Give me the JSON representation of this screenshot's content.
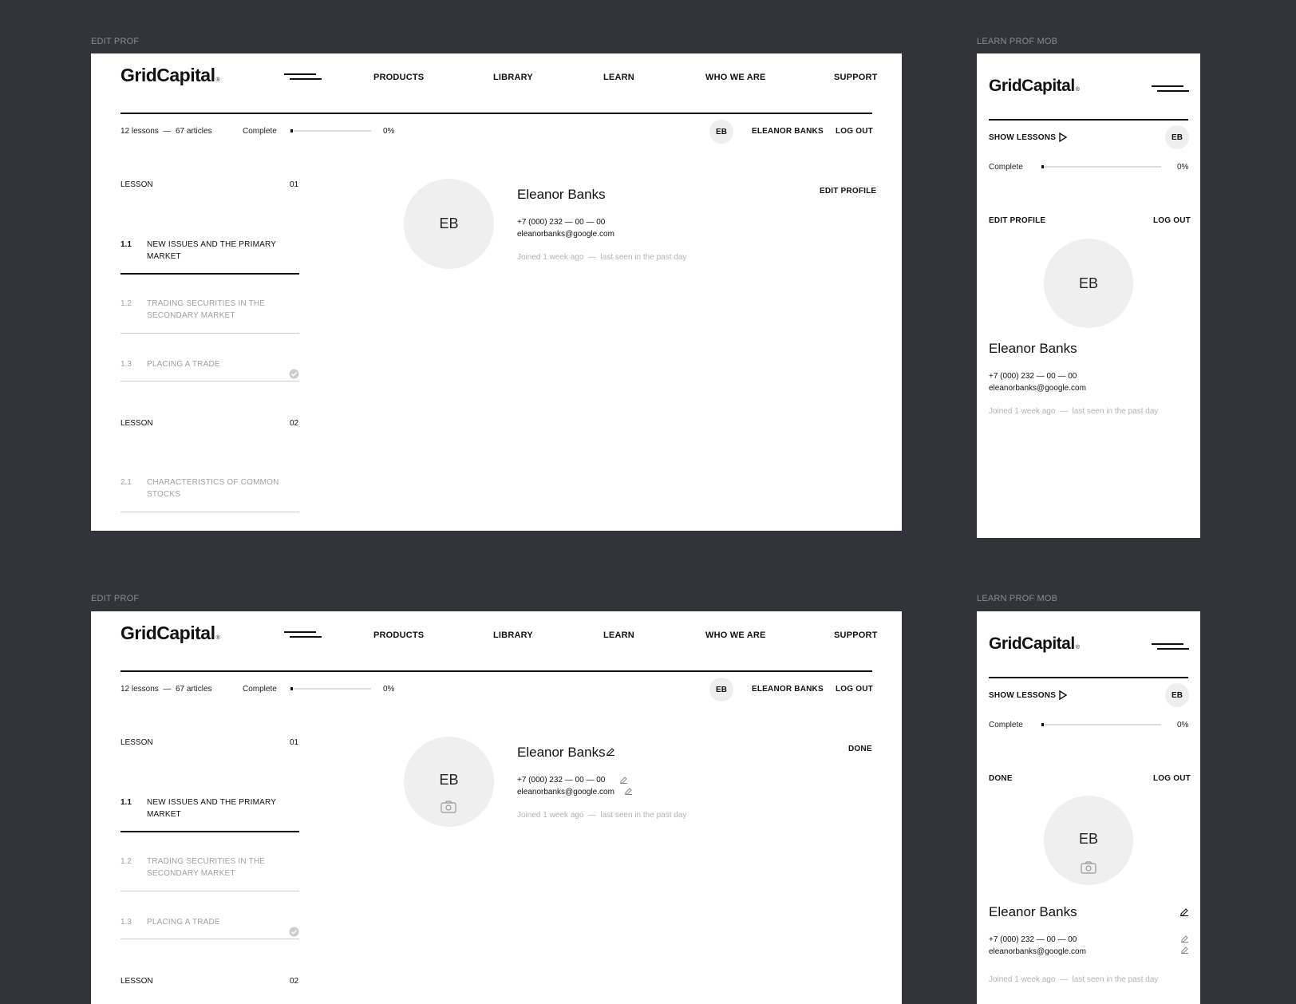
{
  "frames": {
    "desktop_label": "EDIT PROF",
    "mobile_label": "LEARN PROF MOB"
  },
  "brand": {
    "logo": "GridCapital",
    "logo_mark": "®"
  },
  "nav": {
    "products": "PRODUCTS",
    "library": "LIBRARY",
    "learn": "LEARN",
    "who_we_are": "WHO WE ARE",
    "support": "SUPPORT"
  },
  "progress_bar": {
    "lessons": "12 lessons",
    "dash": "—",
    "articles": "67 articles",
    "complete_label": "Complete",
    "percent": "0%",
    "complete_fraction": 0
  },
  "user": {
    "initials": "EB",
    "name_upper": "ELEANOR BANKS",
    "name": "Eleanor Banks",
    "phone": "+7 (000) 232 — 00 — 00",
    "email": "eleanorbanks@google.com",
    "joined": "Joined 1 week ago",
    "dash": "—",
    "last_seen": "last seen in the past day"
  },
  "actions": {
    "logout": "LOG OUT",
    "edit_profile": "EDIT PROFILE",
    "done": "DONE",
    "show_lessons": "SHOW LESSONS"
  },
  "lessons": [
    {
      "label": "LESSON",
      "number": "01",
      "items": [
        {
          "num": "1.1",
          "title": "NEW ISSUES AND THE PRIMARY MARKET"
        },
        {
          "num": "1.2",
          "title": "TRADING SECURITIES IN THE SECONDARY MARKET"
        },
        {
          "num": "1.3",
          "title": "PLACING A TRADE"
        }
      ]
    },
    {
      "label": "LESSON",
      "number": "02",
      "items": [
        {
          "num": "2.1",
          "title": "CHARACTERISTICS OF COMMON STOCKS"
        }
      ]
    }
  ],
  "colors": {
    "background": "#33343b",
    "frame": "#ffffff",
    "avatar": "#efefef",
    "muted_text": "#a0a0a0"
  }
}
